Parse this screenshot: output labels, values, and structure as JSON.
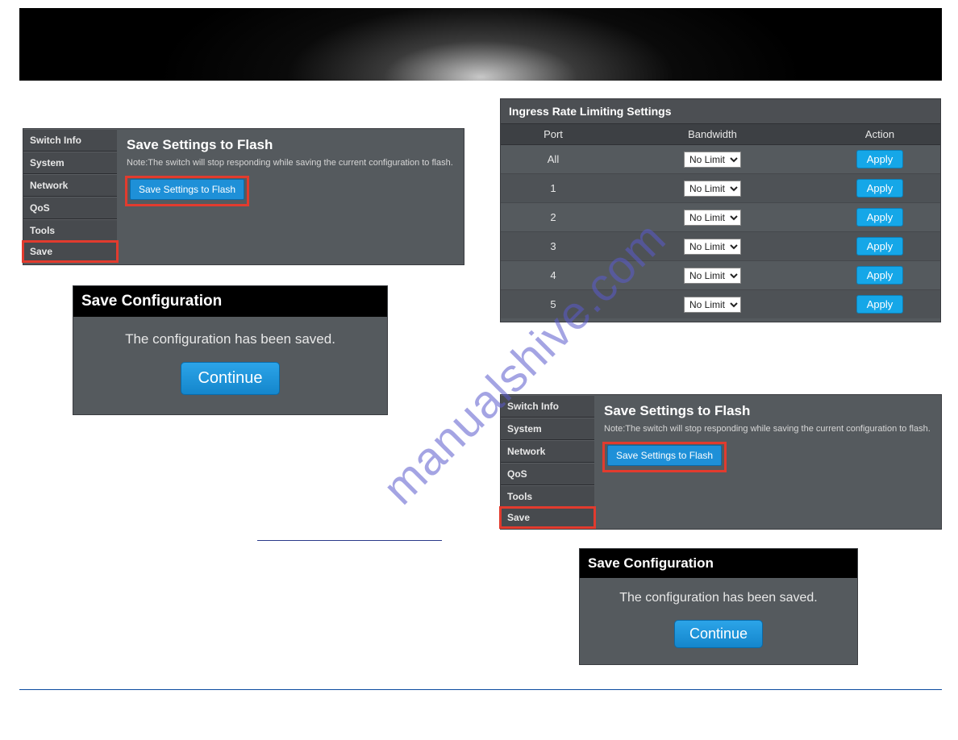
{
  "watermark": "manualshive.com",
  "sidebar": {
    "items": [
      "Switch Info",
      "System",
      "Network",
      "QoS",
      "Tools",
      "Save"
    ]
  },
  "save_panel": {
    "title": "Save Settings to Flash",
    "note": "Note:The switch will stop responding while saving the current configuration to flash.",
    "button": "Save Settings to Flash"
  },
  "dialog": {
    "title": "Save Configuration",
    "message": "The configuration has been saved.",
    "button": "Continue"
  },
  "ingress": {
    "title": "Ingress Rate Limiting Settings",
    "headers": {
      "port": "Port",
      "bandwidth": "Bandwidth",
      "action": "Action"
    },
    "option": "No Limit",
    "apply": "Apply",
    "rows": [
      "All",
      "1",
      "2",
      "3",
      "4",
      "5"
    ]
  }
}
